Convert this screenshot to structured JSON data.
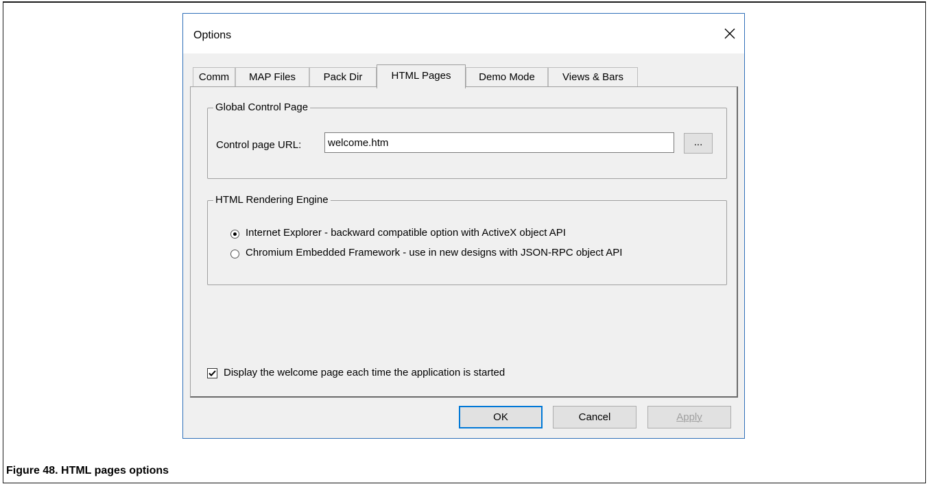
{
  "dialog": {
    "title": "Options",
    "close_icon": "close-icon"
  },
  "tabs": [
    {
      "label": "Comm",
      "active": false
    },
    {
      "label": "MAP Files",
      "active": false
    },
    {
      "label": "Pack Dir",
      "active": false
    },
    {
      "label": "HTML Pages",
      "active": true
    },
    {
      "label": "Demo Mode",
      "active": false
    },
    {
      "label": "Views & Bars",
      "active": false
    }
  ],
  "global_control": {
    "group_label": "Global Control Page",
    "url_label": "Control page URL:",
    "url_value": "welcome.htm",
    "browse_label": "..."
  },
  "rendering_engine": {
    "group_label": "HTML Rendering Engine",
    "options": [
      {
        "label": "Internet Explorer - backward compatible option with ActiveX object API",
        "selected": true
      },
      {
        "label": "Chromium Embedded Framework - use in new designs with JSON-RPC object API",
        "selected": false
      }
    ]
  },
  "welcome_checkbox": {
    "label": "Display the welcome page each time the application is started",
    "checked": true
  },
  "buttons": {
    "ok": "OK",
    "cancel": "Cancel",
    "apply": "Apply"
  },
  "figure_caption": "Figure 48. HTML pages options"
}
